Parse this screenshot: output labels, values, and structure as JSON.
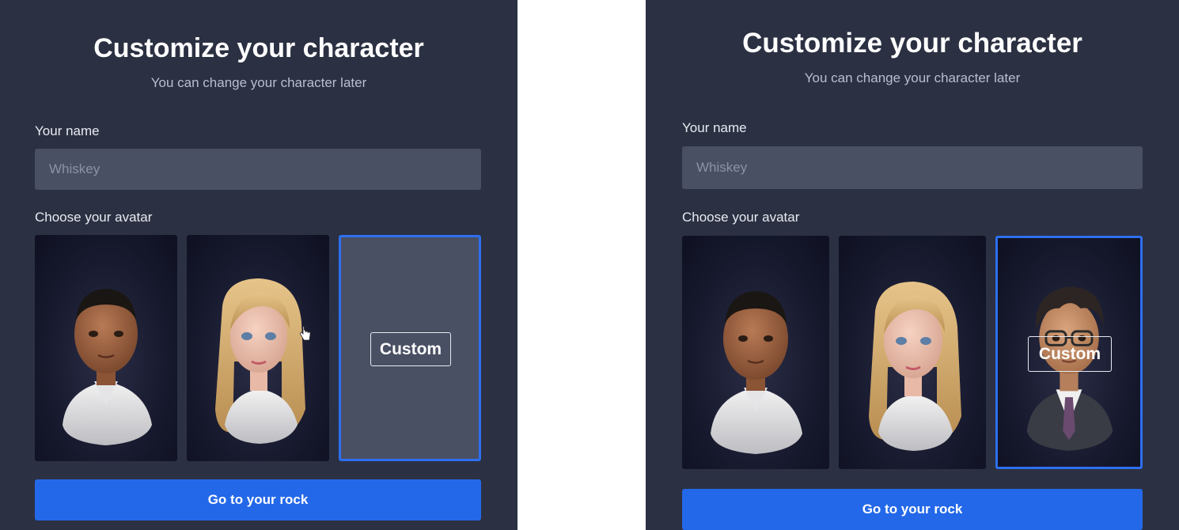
{
  "left": {
    "title": "Customize your character",
    "subtitle": "You can change your character later",
    "name_label": "Your name",
    "name_placeholder": "Whiskey",
    "avatar_label": "Choose your avatar",
    "avatars": [
      {
        "icon": "male-avatar-icon"
      },
      {
        "icon": "female-avatar-icon"
      },
      {
        "label": "Custom",
        "selected": true
      }
    ],
    "button_label": "Go to your rock"
  },
  "right": {
    "title": "Customize your character",
    "subtitle": "You can change your character later",
    "name_label": "Your name",
    "name_placeholder": "Whiskey",
    "avatar_label": "Choose your avatar",
    "avatars": [
      {
        "icon": "male-avatar-icon"
      },
      {
        "icon": "female-avatar-icon"
      },
      {
        "label": "Custom",
        "selected": true,
        "icon": "custom-avatar-icon"
      }
    ],
    "button_label": "Go to your rock"
  },
  "colors": {
    "panel_bg": "#2b3042",
    "input_bg": "#4a5063",
    "accent": "#2368e8",
    "selected_border": "#2d6ff0"
  }
}
